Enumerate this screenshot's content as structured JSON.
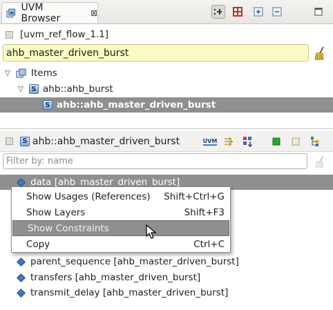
{
  "view": {
    "title": "UVM Browser",
    "close_glyph": "⊠"
  },
  "toolbar": {
    "buttons": [
      {
        "name": "link-with-editor-icon",
        "pressed": true
      },
      {
        "name": "hierarchy-red-icon",
        "pressed": false
      },
      {
        "name": "expand-all-icon",
        "pressed": false
      },
      {
        "name": "collapse-all-icon",
        "pressed": false
      },
      {
        "name": "maximize-icon",
        "pressed": false
      }
    ]
  },
  "breadcrumb": {
    "label": "[uvm_ref_flow_1.1]"
  },
  "search": {
    "value": "ahb_master_driven_burst"
  },
  "tree": {
    "items": [
      {
        "label": "Items",
        "expanded": true,
        "icon": "items-icon"
      },
      {
        "label": "ahb::ahb_burst",
        "expanded": true,
        "icon": "sequence-icon"
      },
      {
        "label": "ahb::ahb_master_driven_burst",
        "selected": true,
        "icon": "sequence-icon"
      }
    ]
  },
  "detail": {
    "title": "ahb::ahb_master_driven_burst",
    "buttons": [
      "uvm-icon",
      "filter-arrows-icon",
      "sort-icon",
      "green-square-icon",
      "empty-square-icon",
      "hierarchy-tree-icon"
    ],
    "uvm_label": "UVM"
  },
  "filter": {
    "placeholder": "Filter by: name"
  },
  "fields": [
    {
      "label": "data [ahb_master_driven_burst]",
      "selected": true
    },
    {
      "label": "parent_sequence [ahb_master_driven_burst]"
    },
    {
      "label": "transfers [ahb_master_driven_burst]"
    },
    {
      "label": "transmit_delay [ahb_master_driven_burst]"
    }
  ],
  "context_menu": {
    "items": [
      {
        "label": "Show Usages (References)",
        "shortcut": "Shift+Ctrl+G"
      },
      {
        "label": "Show Layers",
        "shortcut": "Shift+F3"
      },
      {
        "label": "Show Constraints",
        "shortcut": "",
        "hover": true
      },
      {
        "label": "Copy",
        "shortcut": "Ctrl+C"
      }
    ]
  },
  "colors": {
    "selection": "#8f8f8f",
    "search_bg": "#fbfbc4",
    "accent_blue": "#3f78c4"
  }
}
